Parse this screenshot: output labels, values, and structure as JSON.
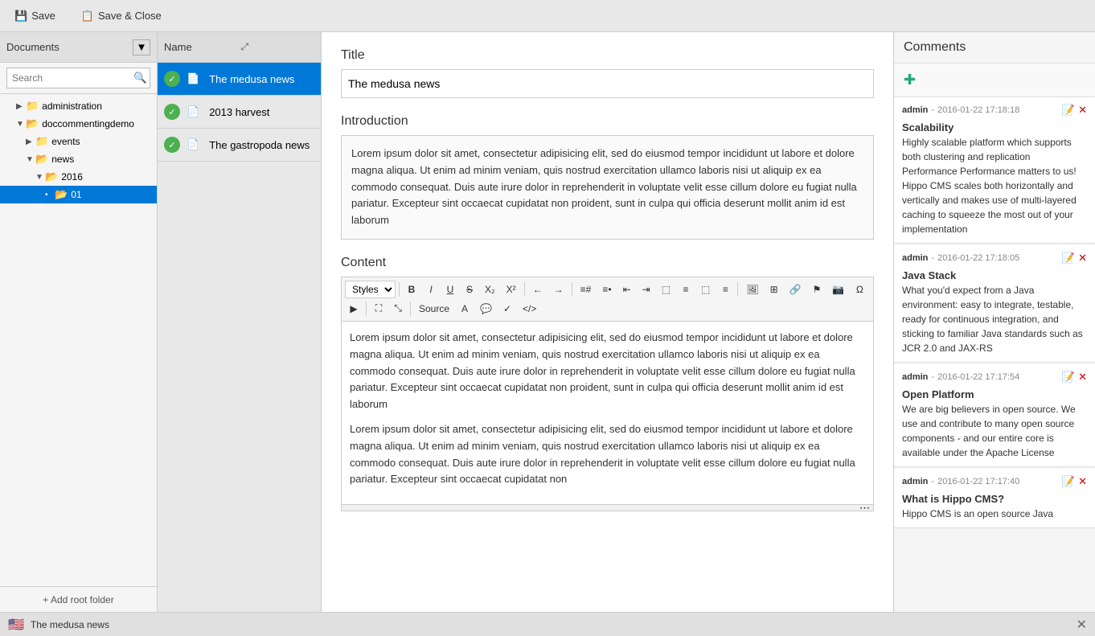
{
  "toolbar": {
    "save_label": "Save",
    "save_close_label": "Save & Close"
  },
  "sidebar": {
    "header": "Documents",
    "search_placeholder": "Search",
    "tree": [
      {
        "id": "admin",
        "label": "administration",
        "indent": 1,
        "type": "folder",
        "collapsed": true,
        "arrow": "▶"
      },
      {
        "id": "doccommentingdemo",
        "label": "doccommentingdemo",
        "indent": 1,
        "type": "folder-open",
        "arrow": "▼"
      },
      {
        "id": "events",
        "label": "events",
        "indent": 2,
        "type": "folder",
        "arrow": "▶"
      },
      {
        "id": "news",
        "label": "news",
        "indent": 2,
        "type": "folder-open",
        "arrow": "▼"
      },
      {
        "id": "2016",
        "label": "2016",
        "indent": 3,
        "type": "folder-open",
        "arrow": "▼"
      },
      {
        "id": "01",
        "label": "01",
        "indent": 4,
        "type": "folder-selected",
        "arrow": "•",
        "selected": true
      }
    ],
    "add_root_label": "+ Add root folder"
  },
  "doc_list": {
    "header": "Name",
    "items": [
      {
        "id": "medusa",
        "label": "The medusa news",
        "active": true,
        "check": true
      },
      {
        "id": "harvest",
        "label": "2013 harvest",
        "active": false,
        "check": true
      },
      {
        "id": "gastropoda",
        "label": "The gastropoda news",
        "active": false,
        "check": true
      }
    ]
  },
  "editor": {
    "title_label": "Title",
    "title_value": "The medusa news",
    "intro_label": "Introduction",
    "intro_text": "Lorem ipsum dolor sit amet, consectetur adipisicing elit, sed do eiusmod tempor incididunt ut labore et dolore magna aliqua. Ut enim ad minim veniam, quis nostrud exercitation ullamco laboris nisi ut aliquip ex ea commodo consequat. Duis aute irure dolor in reprehenderit in voluptate velit esse cillum dolore eu fugiat nulla pariatur. Excepteur sint occaecat cupidatat non proident, sunt in culpa qui officia deserunt mollit anim id est laborum",
    "content_label": "Content",
    "styles_label": "Styles",
    "content_para1": "Lorem ipsum dolor sit amet, consectetur adipisicing elit, sed do eiusmod tempor incididunt ut labore et dolore magna aliqua. Ut enim ad minim veniam, quis nostrud exercitation ullamco laboris nisi ut aliquip ex ea commodo consequat. Duis aute irure dolor in reprehenderit in voluptate velit esse cillum dolore eu fugiat nulla pariatur. Excepteur sint occaecat cupidatat non proident, sunt in culpa qui officia deserunt mollit anim id est laborum",
    "content_para2": "Lorem ipsum dolor sit amet, consectetur adipisicing elit, sed do eiusmod tempor incididunt ut labore et dolore magna aliqua. Ut enim ad minim veniam, quis nostrud exercitation ullamco laboris nisi ut aliquip ex ea commodo consequat. Duis aute irure dolor in reprehenderit in voluptate velit esse cillum dolore eu fugiat nulla pariatur. Excepteur sint occaecat cupidatat non"
  },
  "comments": {
    "header": "Comments",
    "items": [
      {
        "id": "c1",
        "admin": "admin",
        "time": "2016-01-22 17:18:18",
        "title": "Scalability",
        "body": "Highly scalable platform which supports both clustering and replication\nPerformance\nPerformance matters to us! Hippo CMS  scales both  horizontally and vertically and makes use of  multi-layered caching to squeeze the most out of your implementation"
      },
      {
        "id": "c2",
        "admin": "admin",
        "time": "2016-01-22 17:18:05",
        "title": "Java Stack",
        "body": "What you'd expect from a Java environment: easy to integrate, testable, ready for continuous integration, and sticking to familiar Java standards such as JCR 2.0 and JAX-RS"
      },
      {
        "id": "c3",
        "admin": "admin",
        "time": "2016-01-22 17:17:54",
        "title": "Open Platform",
        "body": "We are big believers in open source. We use and contribute to many open source components - and our entire core is available under the Apache License"
      },
      {
        "id": "c4",
        "admin": "admin",
        "time": "2016-01-22 17:17:40",
        "title": "What is Hippo CMS?",
        "body": "Hippo CMS is an open source Java"
      }
    ]
  },
  "bottom_bar": {
    "flag": "🇺🇸",
    "title": "The medusa news",
    "close_icon": "✕"
  }
}
